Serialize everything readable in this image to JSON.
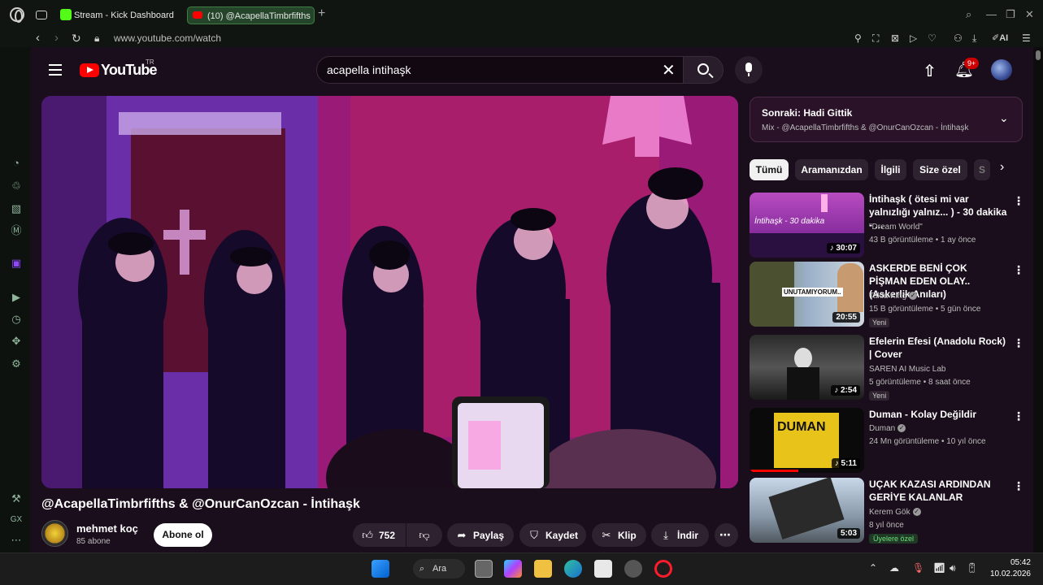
{
  "browser": {
    "tabs": [
      {
        "label": "Stream - Kick Dashboard",
        "active": false
      },
      {
        "label": "(10) @AcapellaTimbrfifths",
        "active": true
      }
    ],
    "url": "www.youtube.com/watch",
    "ai_label": "AI"
  },
  "youtube": {
    "logo_text": "YouTube",
    "country": "TR",
    "search_value": "acapella intihaşk",
    "notifications": "9+"
  },
  "video": {
    "title": "@AcapellaTimbrfifths & @OnurCanOzcan - İntihaşk",
    "channel_name": "mehmet koç",
    "channel_subs": "85 abone",
    "subscribe_label": "Abone ol",
    "likes": "752",
    "share_label": "Paylaş",
    "save_label": "Kaydet",
    "clip_label": "Klip",
    "download_label": "İndir"
  },
  "upnext": {
    "title": "Sonraki: Hadi Gittik",
    "subtitle": "Mix - @AcapellaTimbrfifths & @OnurCanOzcan - İntihaşk"
  },
  "chips": [
    "Tümü",
    "Aramanızdan",
    "İlgili",
    "Size özel",
    "S"
  ],
  "recommendations": [
    {
      "title": "İntihaşk ( ötesi mi var yalnızlığı yalnız... ) - 30 dakika - ...",
      "channel": "\"Dream World\"",
      "meta": "43 B görüntüleme • 1 ay önce",
      "duration": "30:07",
      "thumb_text": "İntihaşk - 30 dakika",
      "badge": ""
    },
    {
      "title": "ASKERDE BENİ ÇOK PİŞMAN EDEN OLAY.. (Askerlik Anıları)",
      "channel": "Takla King",
      "meta": "15 B görüntüleme • 5 gün önce",
      "duration": "20:55",
      "thumb_text": "UNUTAMIYORUM..",
      "badge": "Yeni"
    },
    {
      "title": "Efelerin Efesi (Anadolu Rock) | Cover",
      "channel": "SAREN AI Music Lab",
      "meta": "5 görüntüleme • 8 saat önce",
      "duration": "2:54",
      "thumb_text": "",
      "badge": "Yeni"
    },
    {
      "title": "Duman - Kolay Değildir",
      "channel": "Duman",
      "meta": "24 Mn görüntüleme • 10 yıl önce",
      "duration": "5:11",
      "thumb_text": "DUMAN",
      "badge": ""
    },
    {
      "title": "UÇAK KAZASI ARDINDAN GERİYE KALANLAR",
      "channel": "Kerem Gök",
      "meta": "8 yıl önce",
      "duration": "5:03",
      "thumb_text": "",
      "badge": "Üyelere özel"
    }
  ],
  "taskbar": {
    "search_label": "Ara",
    "time": "05:42",
    "date": "10.02.2026"
  }
}
